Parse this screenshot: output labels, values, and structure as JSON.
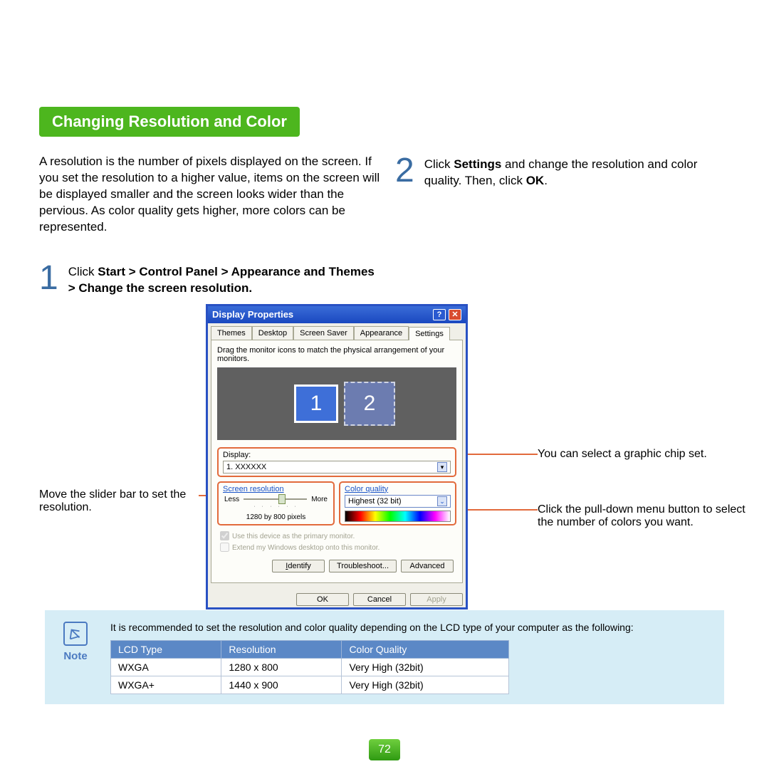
{
  "heading": "Changing Resolution and Color",
  "intro": "A resolution is the number of pixels displayed on the screen. If you set the resolution to a higher value, items on the screen will be displayed smaller and the screen looks wider than the pervious. As color quality gets higher, more colors can be represented.",
  "step1": {
    "num": "1",
    "prefix": "Click ",
    "bold": "Start > Control Panel > Appearance and Themes > Change the screen resolution."
  },
  "step2": {
    "num": "2",
    "t1": "Click ",
    "b1": "Settings",
    "t2": " and change the resolution and color quality. Then, click ",
    "b2": "OK",
    "t3": "."
  },
  "dialog": {
    "title": "Display Properties",
    "tabs": [
      "Themes",
      "Desktop",
      "Screen Saver",
      "Appearance",
      "Settings"
    ],
    "active_tab": 4,
    "instruction": "Drag the monitor icons to match the physical arrangement of your monitors.",
    "mon1": "1",
    "mon2": "2",
    "display_label": "Display:",
    "display_value": "1.  XXXXXX",
    "sr_title": "Screen resolution",
    "sr_less": "Less",
    "sr_more": "More",
    "sr_value": "1280 by 800 pixels",
    "cq_title": "Color quality",
    "cq_value": "Highest (32 bit)",
    "check1": "Use this device as the primary monitor.",
    "check2": "Extend my Windows desktop onto this monitor.",
    "identify": "Identify",
    "troubleshoot": "Troubleshoot...",
    "advanced": "Advanced",
    "ok": "OK",
    "cancel": "Cancel",
    "apply": "Apply"
  },
  "ann": {
    "left": "Move the slider bar to set the resolution.",
    "r1": "You can select a graphic chip set.",
    "r2": "Click the pull-down menu button to select the number of colors you want."
  },
  "note": {
    "label": "Note",
    "text": "It is recommended to set the resolution and color quality depending on the LCD type of your computer as the following:",
    "headers": [
      "LCD Type",
      "Resolution",
      "Color Quality"
    ],
    "rows": [
      [
        "WXGA",
        "1280 x 800",
        "Very High (32bit)"
      ],
      [
        "WXGA+",
        "1440 x 900",
        "Very High (32bit)"
      ]
    ]
  },
  "page_number": "72"
}
